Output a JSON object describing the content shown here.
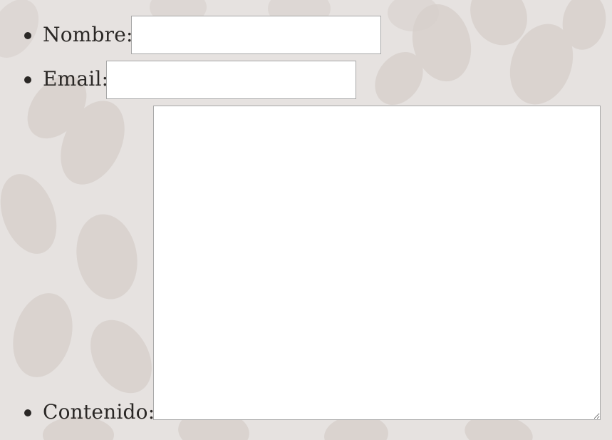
{
  "form": {
    "fields": [
      {
        "label": "Nombre:",
        "value": "",
        "type": "text"
      },
      {
        "label": "Email:",
        "value": "",
        "type": "email"
      },
      {
        "label": "Contenido:",
        "value": "",
        "type": "textarea"
      }
    ]
  },
  "colors": {
    "background": "#e6e2e0",
    "text": "#2a2725",
    "field_background": "#ffffff",
    "field_border": "#a7a7a7"
  },
  "icons": {
    "list_marker": "bullet-icon",
    "textarea_resize": "resize-grip-icon"
  }
}
